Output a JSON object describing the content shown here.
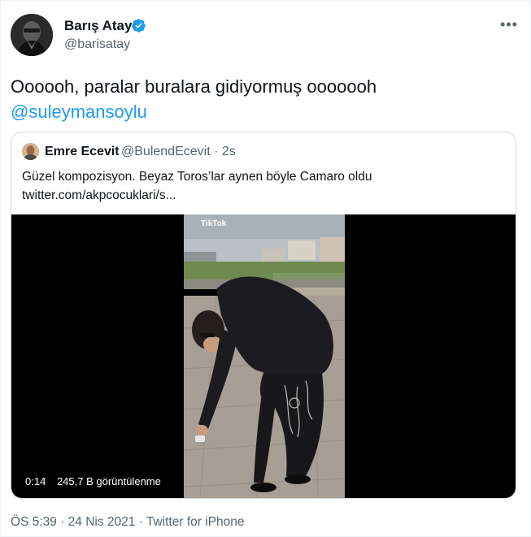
{
  "author": {
    "name": "Barış Atay",
    "handle": "@barisatay",
    "verified": true,
    "avatar_icon": "avatar-photo"
  },
  "tweet": {
    "text": "Oooooh, paralar buralara gidiyormuş ooooooh",
    "mention": "@suleymansoylu"
  },
  "quoted_tweet": {
    "name": "Emre Ecevit",
    "handle": "@BulendEcevit",
    "separator": "·",
    "time": "2s",
    "text_line1": "Güzel kompozisyon. Beyaz Toros’lar aynen böyle Camaro oldu",
    "text_line2": "twitter.com/akpcocuklari/s...",
    "video": {
      "watermark": "TikTok",
      "duration": "0:14",
      "views": "245,7 B görüntülenme"
    }
  },
  "footer": {
    "time": "ÖS 5:39",
    "separator1": "·",
    "date": "24 Nis 2021",
    "separator2": "·",
    "source": "Twitter for iPhone"
  },
  "colors": {
    "link": "#1d9bf0",
    "secondary_text": "#536471",
    "border": "#cfd9de"
  }
}
